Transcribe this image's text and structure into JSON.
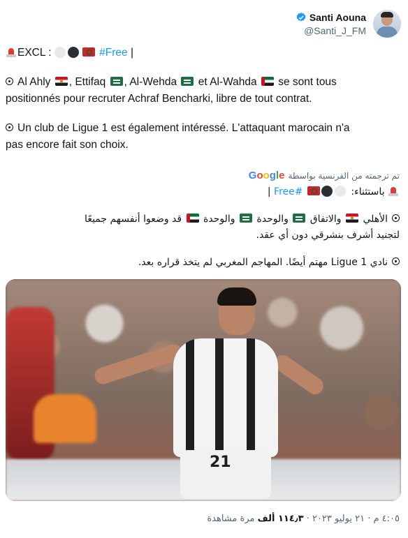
{
  "author": {
    "display_name": "Santi Aouna",
    "handle": "@Santi_J_FM",
    "verified": true,
    "avatar_icon": "profile-photo"
  },
  "tweet_fr": {
    "line1_prefix": "EXCL :",
    "line1_link": "#Free",
    "line1_suffix": " |",
    "para1_a": "Al Ahly",
    "para1_b": ", Ettifaq",
    "para1_c": ", Al-Wehda",
    "para1_d": " et Al-Wahda",
    "para1_e": " se sont tous",
    "para1_line2": "positionnés pour recruter Achraf Bencharki, libre de tout contrat.",
    "para2_line1": "Un club de Ligue 1 est également intéressé. L'attaquant marocain n'a",
    "para2_line2": "pas encore fait son choix."
  },
  "translation": {
    "label": "تم ترجمته من الفرنسية بواسطة",
    "provider": "Google"
  },
  "tweet_ar": {
    "line1_prefix": "باستثناء:",
    "line1_link": "#Free",
    "line1_suffix": " |",
    "para1_a": "الأهلي",
    "para1_b": " والاتفاق",
    "para1_c": " والوحدة",
    "para1_d": " والوحدة",
    "para1_e": " قد وضعوا أنفسهم جميعًا",
    "para1_line2": "لتجنيد أشرف بنشرقي دون أي عقد.",
    "para2": "نادي Ligue 1 مهتم أيضًا. المهاجم المغربي لم يتخذ قراره بعد."
  },
  "media": {
    "jersey_number": "21"
  },
  "meta": {
    "time": "٤:٠٥ م",
    "date": "٢١ يوليو ٢٠٢٣",
    "views_count": "١١٤٫٣ ألف",
    "views_label": "مرة مشاهدة",
    "sep": " · "
  },
  "colors": {
    "link": "#1d9bf0",
    "muted": "#536471",
    "text": "#0f1419",
    "verified": "#1d9bf0"
  },
  "icons": [
    "siren-icon",
    "white-circle-icon",
    "black-circle-icon",
    "morocco-flag-icon",
    "egypt-flag-icon",
    "saudi-flag-icon",
    "uae-flag-icon",
    "bullet-icon",
    "verified-badge-icon"
  ]
}
